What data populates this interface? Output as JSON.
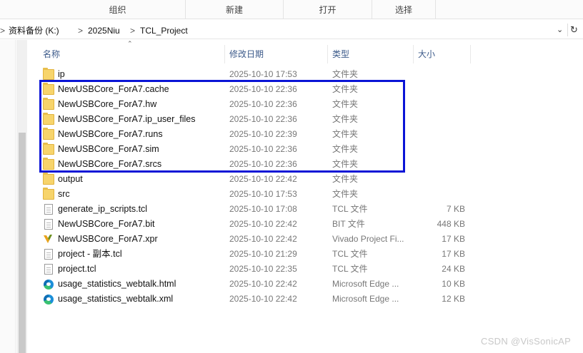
{
  "ribbon": {
    "groups": [
      "组织",
      "新建",
      "打开",
      "选择"
    ]
  },
  "address": {
    "crumbs": [
      "资料备份 (K:)",
      "2025Niu",
      "TCL_Project"
    ],
    "separator": ">"
  },
  "columns": {
    "name": "名称",
    "date": "修改日期",
    "type": "类型",
    "size": "大小"
  },
  "files": [
    {
      "name": "ip",
      "date": "2025-10-10 17:53",
      "type": "文件夹",
      "size": "",
      "icon": "folder-icon"
    },
    {
      "name": "NewUSBCore_ForA7.cache",
      "date": "2025-10-10 22:36",
      "type": "文件夹",
      "size": "",
      "icon": "folder-icon"
    },
    {
      "name": "NewUSBCore_ForA7.hw",
      "date": "2025-10-10 22:36",
      "type": "文件夹",
      "size": "",
      "icon": "folder-icon"
    },
    {
      "name": "NewUSBCore_ForA7.ip_user_files",
      "date": "2025-10-10 22:36",
      "type": "文件夹",
      "size": "",
      "icon": "folder-icon"
    },
    {
      "name": "NewUSBCore_ForA7.runs",
      "date": "2025-10-10 22:39",
      "type": "文件夹",
      "size": "",
      "icon": "folder-icon"
    },
    {
      "name": "NewUSBCore_ForA7.sim",
      "date": "2025-10-10 22:36",
      "type": "文件夹",
      "size": "",
      "icon": "folder-icon"
    },
    {
      "name": "NewUSBCore_ForA7.srcs",
      "date": "2025-10-10 22:36",
      "type": "文件夹",
      "size": "",
      "icon": "folder-icon"
    },
    {
      "name": "output",
      "date": "2025-10-10 22:42",
      "type": "文件夹",
      "size": "",
      "icon": "folder-icon"
    },
    {
      "name": "src",
      "date": "2025-10-10 17:53",
      "type": "文件夹",
      "size": "",
      "icon": "folder-icon"
    },
    {
      "name": "generate_ip_scripts.tcl",
      "date": "2025-10-10 17:08",
      "type": "TCL 文件",
      "size": "7 KB",
      "icon": "tcl-file-icon"
    },
    {
      "name": "NewUSBCore_ForA7.bit",
      "date": "2025-10-10 22:42",
      "type": "BIT 文件",
      "size": "448 KB",
      "icon": "bit-file-icon"
    },
    {
      "name": "NewUSBCore_ForA7.xpr",
      "date": "2025-10-10 22:42",
      "type": "Vivado Project Fi...",
      "size": "17 KB",
      "icon": "vivado-icon"
    },
    {
      "name": "project - 副本.tcl",
      "date": "2025-10-10 21:29",
      "type": "TCL 文件",
      "size": "17 KB",
      "icon": "tcl-file-icon"
    },
    {
      "name": "project.tcl",
      "date": "2025-10-10 22:35",
      "type": "TCL 文件",
      "size": "24 KB",
      "icon": "tcl-file-icon"
    },
    {
      "name": "usage_statistics_webtalk.html",
      "date": "2025-10-10 22:42",
      "type": "Microsoft Edge ...",
      "size": "10 KB",
      "icon": "edge-icon"
    },
    {
      "name": "usage_statistics_webtalk.xml",
      "date": "2025-10-10 22:42",
      "type": "Microsoft Edge ...",
      "size": "12 KB",
      "icon": "edge-icon"
    }
  ],
  "highlight_color": "#0a14d6",
  "watermark": "CSDN @VisSonicAP"
}
